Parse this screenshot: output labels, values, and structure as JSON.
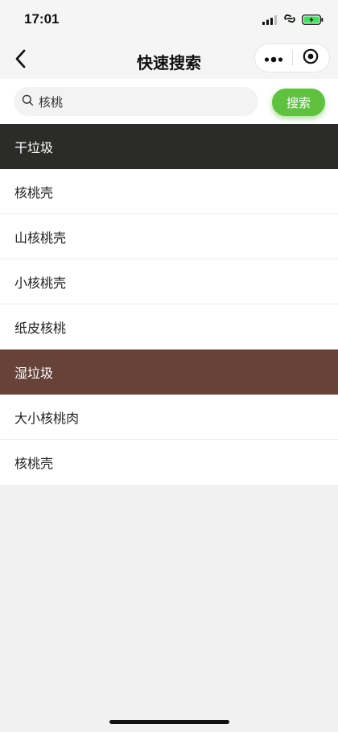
{
  "status": {
    "time": "17:01"
  },
  "nav": {
    "title": "快速搜索"
  },
  "search": {
    "value": "核桃",
    "button_label": "搜索"
  },
  "categories": [
    {
      "name": "干垃圾",
      "color": "#2b2b29",
      "items": [
        "核桃壳",
        "山核桃壳",
        "小核桃壳",
        "纸皮核桃"
      ]
    },
    {
      "name": "湿垃圾",
      "color": "#664239",
      "items": [
        "大小核桃肉",
        "核桃壳"
      ]
    }
  ],
  "colors": {
    "accent": "#5fc13f",
    "battery": "#4cd964"
  }
}
